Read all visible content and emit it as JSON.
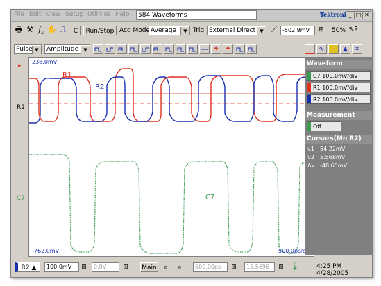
{
  "menu": [
    "File",
    "Edit",
    "View",
    "Setup",
    "Utilities",
    "Help"
  ],
  "waveform_count": "584 Waveforms",
  "brand": "Tektronix",
  "window_buttons": [
    "_",
    "□",
    "✕"
  ],
  "toolbar": {
    "c_label": "C",
    "run_stop": "Run/Stop",
    "acq_mode_label": "Acq Mode",
    "acq_mode_value": "Average",
    "trig_label": "Trig",
    "trig_value": "External Direct",
    "trig_level": "-502.9mV",
    "zoom_pct": "50%"
  },
  "meas_toolbar": {
    "pulse": "Pulse",
    "amplitude": "Amplitude"
  },
  "screen": {
    "top_left": "238.0mV",
    "bottom_left": "-762.0mV",
    "bottom_right": "500.0ps/div",
    "r1": "R1",
    "r2": "R2",
    "c7": "C7",
    "marker_r2": "R2",
    "marker_c7": "C7"
  },
  "right_panel": {
    "waveform_header": "Waveform",
    "ch": [
      {
        "label": "C7 100.0mV/div",
        "color": "#3a9a50"
      },
      {
        "label": "R1 100.0mV/div",
        "color": "#e03020"
      },
      {
        "label": "R2 100.0mV/div",
        "color": "#1830b0"
      }
    ],
    "measurement_header": "Measurement",
    "measurement_state": "Off",
    "cursors_header": "Cursors(Mn R2)",
    "cursors": [
      {
        "name": "v1",
        "value": "54.22mV"
      },
      {
        "name": "v2",
        "value": "5.568mV"
      },
      {
        "name": "Δv",
        "value": "-48.65mV"
      }
    ]
  },
  "bottom": {
    "source": "R2",
    "scale": "100.0mV",
    "offset": "0.0V",
    "main_label": "Main",
    "timebase": "500.00ps",
    "position": "15.5696",
    "time": "4:25 PM 4/28/2005"
  },
  "colors": {
    "c7": "#3a9a50",
    "r1": "#e03020",
    "r2": "#1830b0",
    "panel_header": "#909090"
  }
}
